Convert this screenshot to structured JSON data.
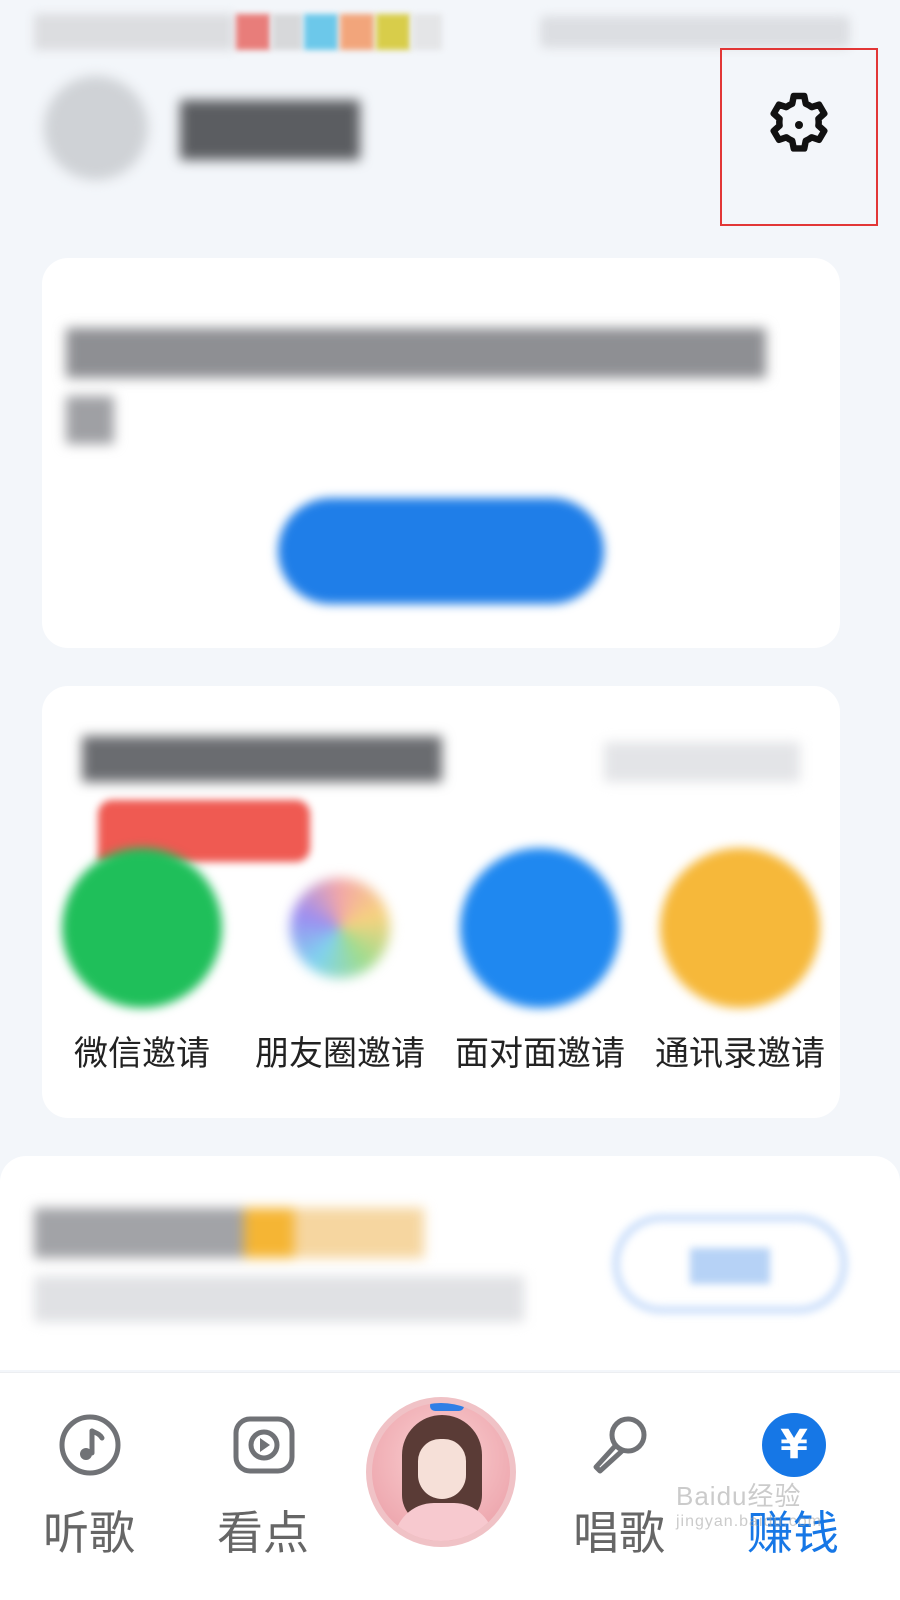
{
  "colors": {
    "accent": "#1677e6",
    "highlight_border": "#e23636",
    "page_background": "#f3f6fa",
    "wechat_green": "#1fbf5a",
    "face_blue": "#1f88f0",
    "contacts_yellow": "#f6b83a"
  },
  "header": {
    "settings_icon": "gear-icon"
  },
  "invite": {
    "items": [
      {
        "label": "微信邀请",
        "icon": "wechat-icon",
        "color": "#1fbf5a"
      },
      {
        "label": "朋友圈邀请",
        "icon": "moments-icon",
        "color": "#f4f4f6"
      },
      {
        "label": "面对面邀请",
        "icon": "face-to-face-icon",
        "color": "#1f88f0"
      },
      {
        "label": "通讯录邀请",
        "icon": "contacts-icon",
        "color": "#f6b83a"
      }
    ]
  },
  "nav": {
    "items": [
      {
        "label": "听歌",
        "icon": "music-note-icon"
      },
      {
        "label": "看点",
        "icon": "play-icon"
      },
      {
        "label": "",
        "icon": "now-playing-avatar"
      },
      {
        "label": "唱歌",
        "icon": "microphone-icon"
      },
      {
        "label": "赚钱",
        "icon": "yuan-icon",
        "active": true
      }
    ],
    "earn_symbol": "¥"
  },
  "watermark": {
    "text": "Baidu经验",
    "sub": "jingyan.baidu.com"
  }
}
